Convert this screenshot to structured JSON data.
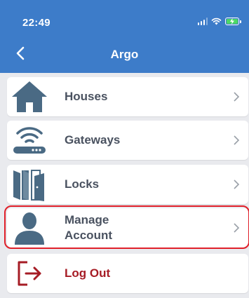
{
  "status_bar": {
    "time": "22:49"
  },
  "header": {
    "title": "Argo",
    "back_icon": "chevron-left-icon"
  },
  "menu": {
    "items": [
      {
        "label": "Houses",
        "icon": "house-icon"
      },
      {
        "label": "Gateways",
        "icon": "gateway-icon"
      },
      {
        "label": "Locks",
        "icon": "doors-icon"
      },
      {
        "label": "Manage\nAccount",
        "icon": "user-icon",
        "highlighted": true
      },
      {
        "label": "Log Out",
        "icon": "logout-icon"
      }
    ]
  },
  "colors": {
    "header_bg": "#3d7cc9",
    "icon": "#4a6a84",
    "label": "#4a5260",
    "logout": "#a61c25",
    "highlight": "#e0202a",
    "battery": "#4cd964"
  }
}
